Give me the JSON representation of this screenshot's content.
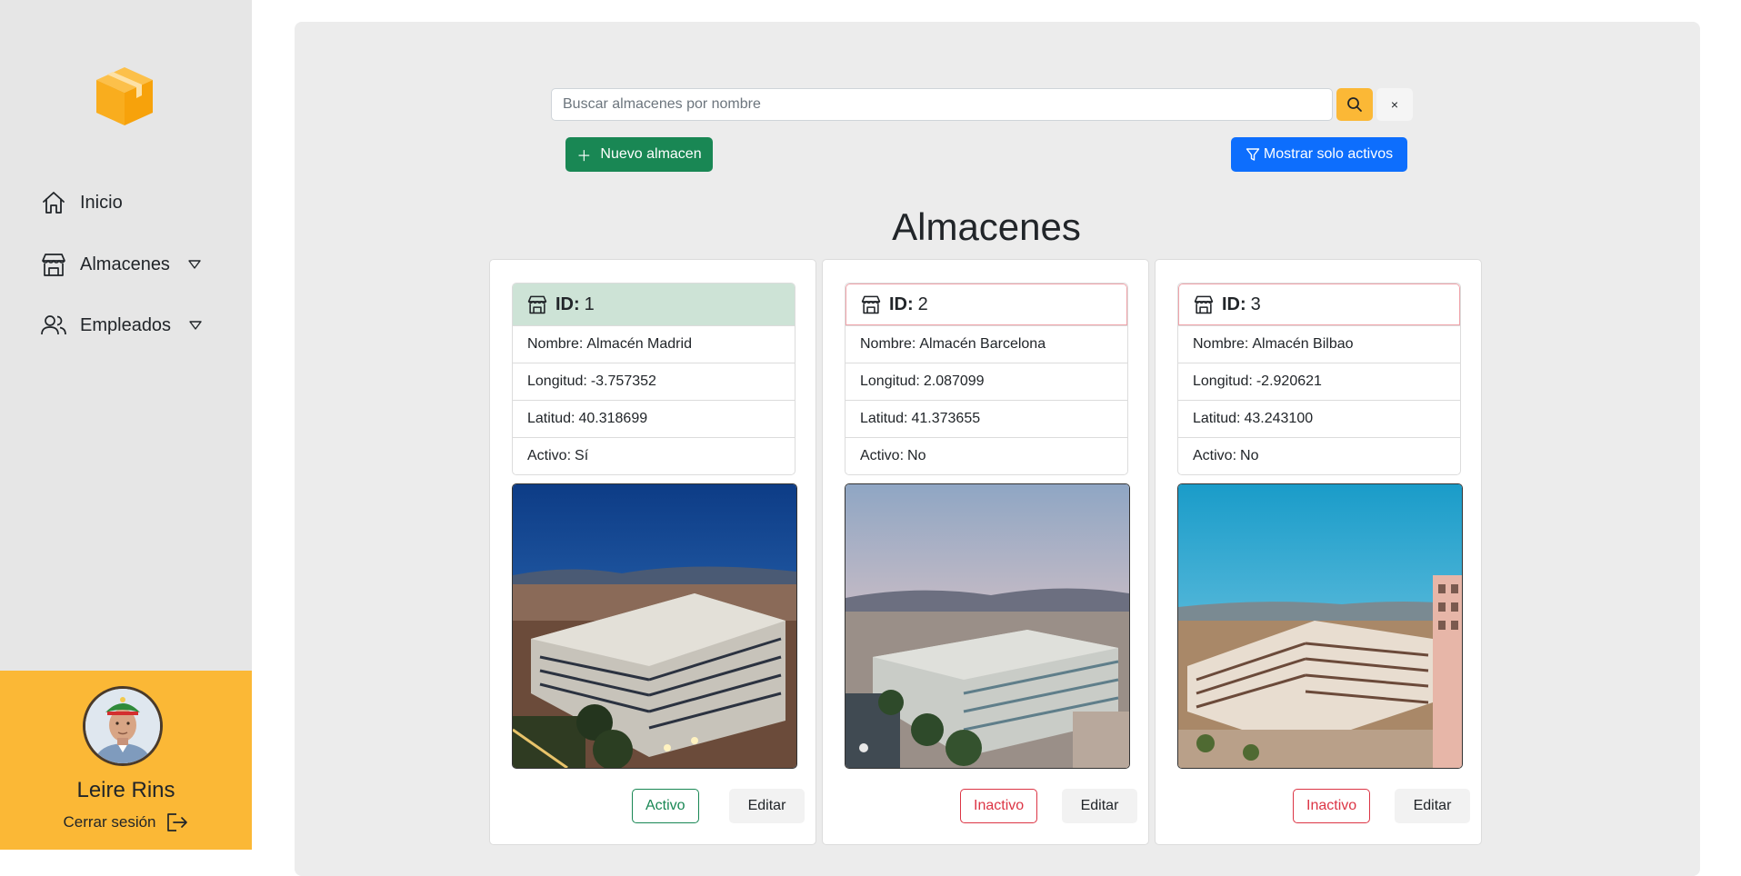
{
  "sidebar": {
    "logo_icon": "box-icon",
    "nav": [
      {
        "label": "Inicio",
        "icon": "home-icon"
      },
      {
        "label": "Almacenes",
        "icon": "store-icon"
      },
      {
        "label": "Empleados",
        "icon": "users-icon"
      }
    ],
    "user": {
      "name": "Leire Rins",
      "logout_label": "Cerrar sesión"
    }
  },
  "toolbar": {
    "search_placeholder": "Buscar almacenes por nombre",
    "clear_label": "×",
    "new_label": "Nuevo almacen",
    "filter_label": "Mostrar solo activos"
  },
  "page": {
    "title": "Almacenes"
  },
  "cards": [
    {
      "id_label": "ID:",
      "id": "1",
      "nombre_label": "Nombre:",
      "nombre": "Almacén Madrid",
      "longitud_label": "Longitud:",
      "longitud": "-3.757352",
      "latitud_label": "Latitud:",
      "latitud": "40.318699",
      "activo_label": "Activo:",
      "activo": "Sí",
      "status_button": "Activo",
      "edit_button": "Editar"
    },
    {
      "id_label": "ID:",
      "id": "2",
      "nombre_label": "Nombre:",
      "nombre": "Almacén Barcelona",
      "longitud_label": "Longitud:",
      "longitud": "2.087099",
      "latitud_label": "Latitud:",
      "latitud": "41.373655",
      "activo_label": "Activo:",
      "activo": "No",
      "status_button": "Inactivo",
      "edit_button": "Editar"
    },
    {
      "id_label": "ID:",
      "id": "3",
      "nombre_label": "Nombre:",
      "nombre": "Almacén Bilbao",
      "longitud_label": "Longitud:",
      "longitud": "-2.920621",
      "latitud_label": "Latitud:",
      "latitud": "43.243100",
      "activo_label": "Activo:",
      "activo": "No",
      "status_button": "Inactivo",
      "edit_button": "Editar"
    }
  ],
  "colors": {
    "sidebar_bg": "#e6e6e6",
    "accent": "#fbb836",
    "success": "#198754",
    "primary": "#0d6efd",
    "danger": "#dc3545"
  }
}
